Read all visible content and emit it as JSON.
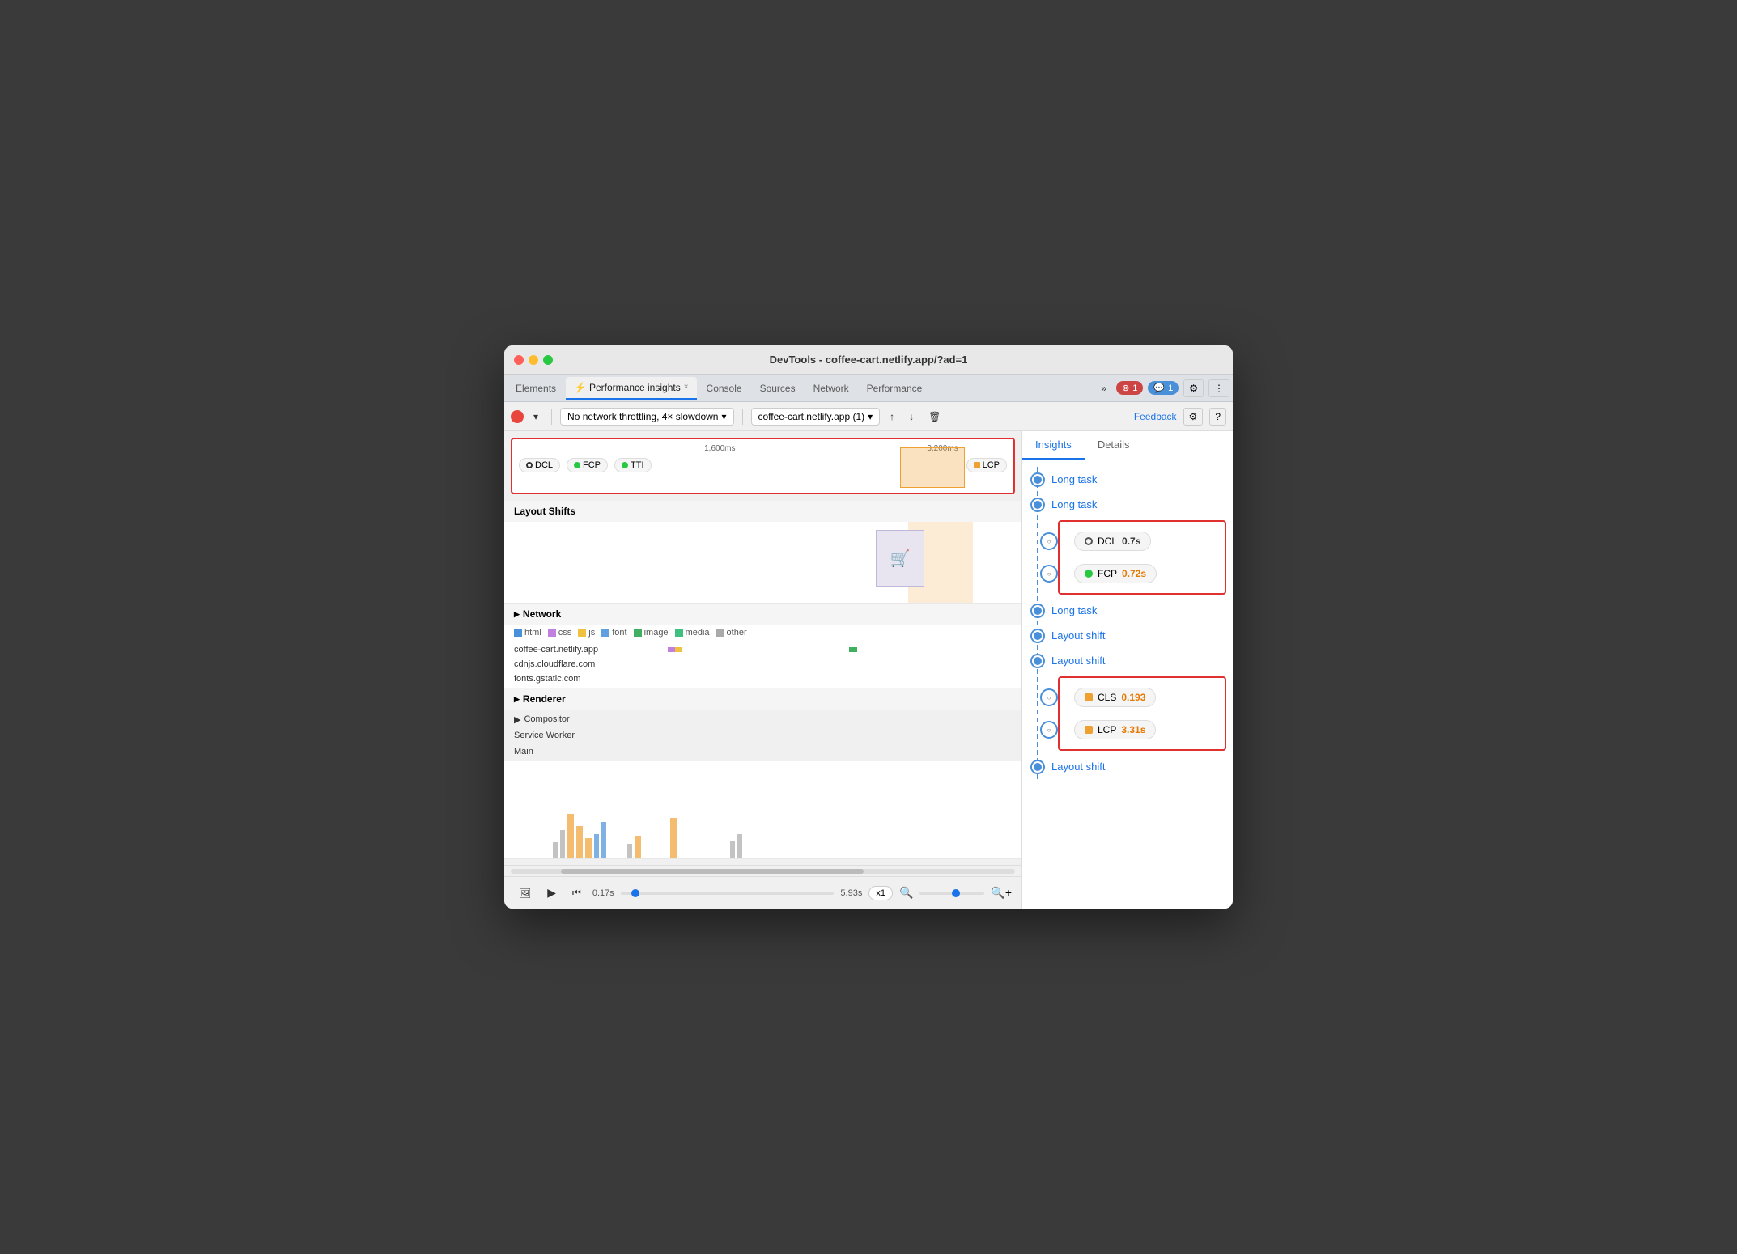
{
  "window": {
    "title": "DevTools - coffee-cart.netlify.app/?ad=1"
  },
  "traffic_lights": {
    "red": "red",
    "yellow": "yellow",
    "green": "green"
  },
  "tabs": [
    {
      "label": "Elements",
      "active": false,
      "icon": ""
    },
    {
      "label": "Performance insights",
      "active": true,
      "icon": "⚡",
      "closeable": true
    },
    {
      "label": "Console",
      "active": false,
      "icon": ""
    },
    {
      "label": "Sources",
      "active": false,
      "icon": ""
    },
    {
      "label": "Network",
      "active": false,
      "icon": ""
    },
    {
      "label": "Performance",
      "active": false,
      "icon": ""
    },
    {
      "label": "more",
      "active": false,
      "icon": "»"
    }
  ],
  "toolbar": {
    "record_label": "",
    "throttling_label": "No network throttling, 4× slowdown",
    "throttling_arrow": "▾",
    "target_label": "coffee-cart.netlify.app (1)",
    "target_arrow": "▾",
    "feedback_label": "Feedback",
    "errors_count": "1",
    "messages_count": "1"
  },
  "timeline": {
    "marker_1600": "1,600ms",
    "marker_3200": "3,200ms",
    "dcl_label": "DCL",
    "fcp_label": "FCP",
    "tti_label": "TTI",
    "lcp_label": "LCP"
  },
  "sections": {
    "layout_shifts_label": "Layout Shifts",
    "network_label": "Network",
    "renderer_label": "Renderer",
    "compositor_label": "Compositor",
    "service_worker_label": "Service Worker",
    "main_label": "Main"
  },
  "network_legend": [
    {
      "color": "#4a90d9",
      "label": "html"
    },
    {
      "color": "#c080e0",
      "label": "css"
    },
    {
      "color": "#f0c040",
      "label": "js"
    },
    {
      "color": "#60a0e0",
      "label": "font"
    },
    {
      "color": "#40b060",
      "label": "image"
    },
    {
      "color": "#40c080",
      "label": "media"
    },
    {
      "color": "#aaaaaa",
      "label": "other"
    }
  ],
  "network_rows": [
    {
      "label": "coffee-cart.netlify.app"
    },
    {
      "label": "cdnjs.cloudflare.com"
    },
    {
      "label": "fonts.gstatic.com"
    }
  ],
  "playback": {
    "start_time": "0.17s",
    "end_time": "5.93s",
    "speed": "x1",
    "play_icon": "▶"
  },
  "insights_tab": "Insights",
  "details_tab": "Details",
  "insights_items": [
    {
      "type": "link",
      "label": "Long task"
    },
    {
      "type": "link",
      "label": "Long task"
    },
    {
      "type": "metric",
      "icon": "circle-empty",
      "label": "DCL",
      "value": "0.7s",
      "value_color": "black"
    },
    {
      "type": "metric",
      "icon": "circle-green",
      "label": "FCP",
      "value": "0.72s",
      "value_color": "orange"
    },
    {
      "type": "link",
      "label": "Long task"
    },
    {
      "type": "link",
      "label": "Layout shift"
    },
    {
      "type": "link",
      "label": "Layout shift"
    },
    {
      "type": "metric",
      "icon": "square-orange",
      "label": "CLS",
      "value": "0.193",
      "value_color": "orange"
    },
    {
      "type": "metric",
      "icon": "square-orange",
      "label": "LCP",
      "value": "3.31s",
      "value_color": "orange"
    },
    {
      "type": "link",
      "label": "Layout shift"
    }
  ]
}
